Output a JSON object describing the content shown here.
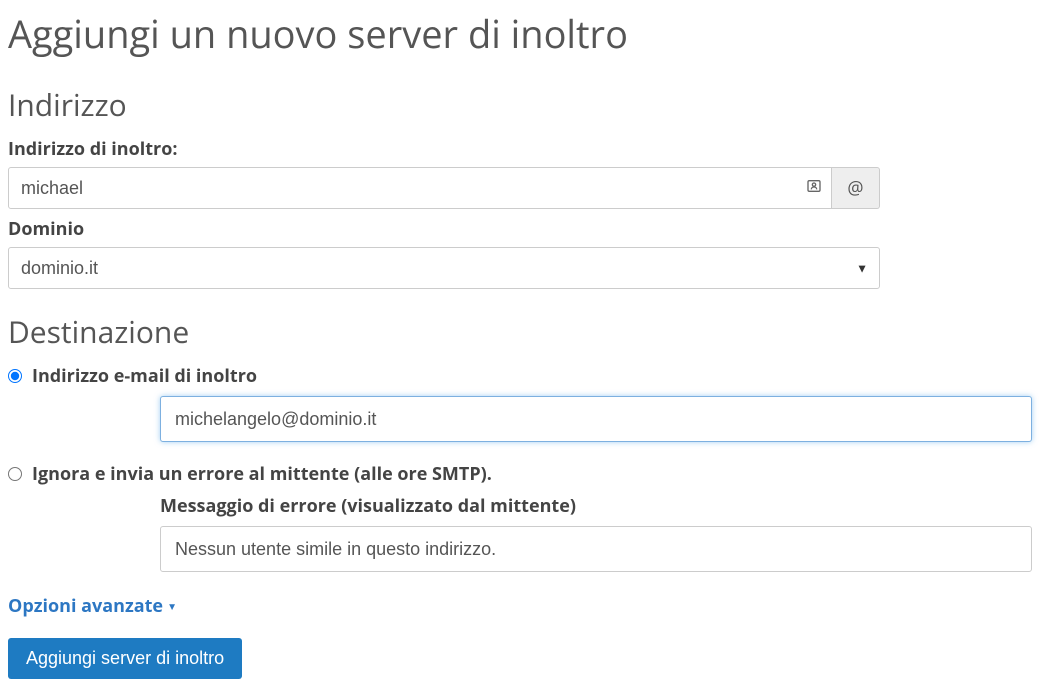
{
  "page": {
    "title": "Aggiungi un nuovo server di inoltro"
  },
  "address": {
    "section_title": "Indirizzo",
    "forward_label": "Indirizzo di inoltro:",
    "forward_value": "michael",
    "at_symbol": "@",
    "domain_label": "Dominio",
    "domain_value": "dominio.it"
  },
  "destination": {
    "section_title": "Destinazione",
    "radio_forward_label": "Indirizzo e-mail di inoltro",
    "forward_email_value": "michelangelo@dominio.it",
    "radio_ignore_label": "Ignora e invia un errore al mittente (alle ore SMTP).",
    "error_message_label": "Messaggio di errore (visualizzato dal mittente)",
    "error_message_value": "Nessun utente simile in questo indirizzo.",
    "selected": "forward"
  },
  "advanced": {
    "label": "Opzioni avanzate"
  },
  "submit": {
    "label": "Aggiungi server di inoltro"
  }
}
